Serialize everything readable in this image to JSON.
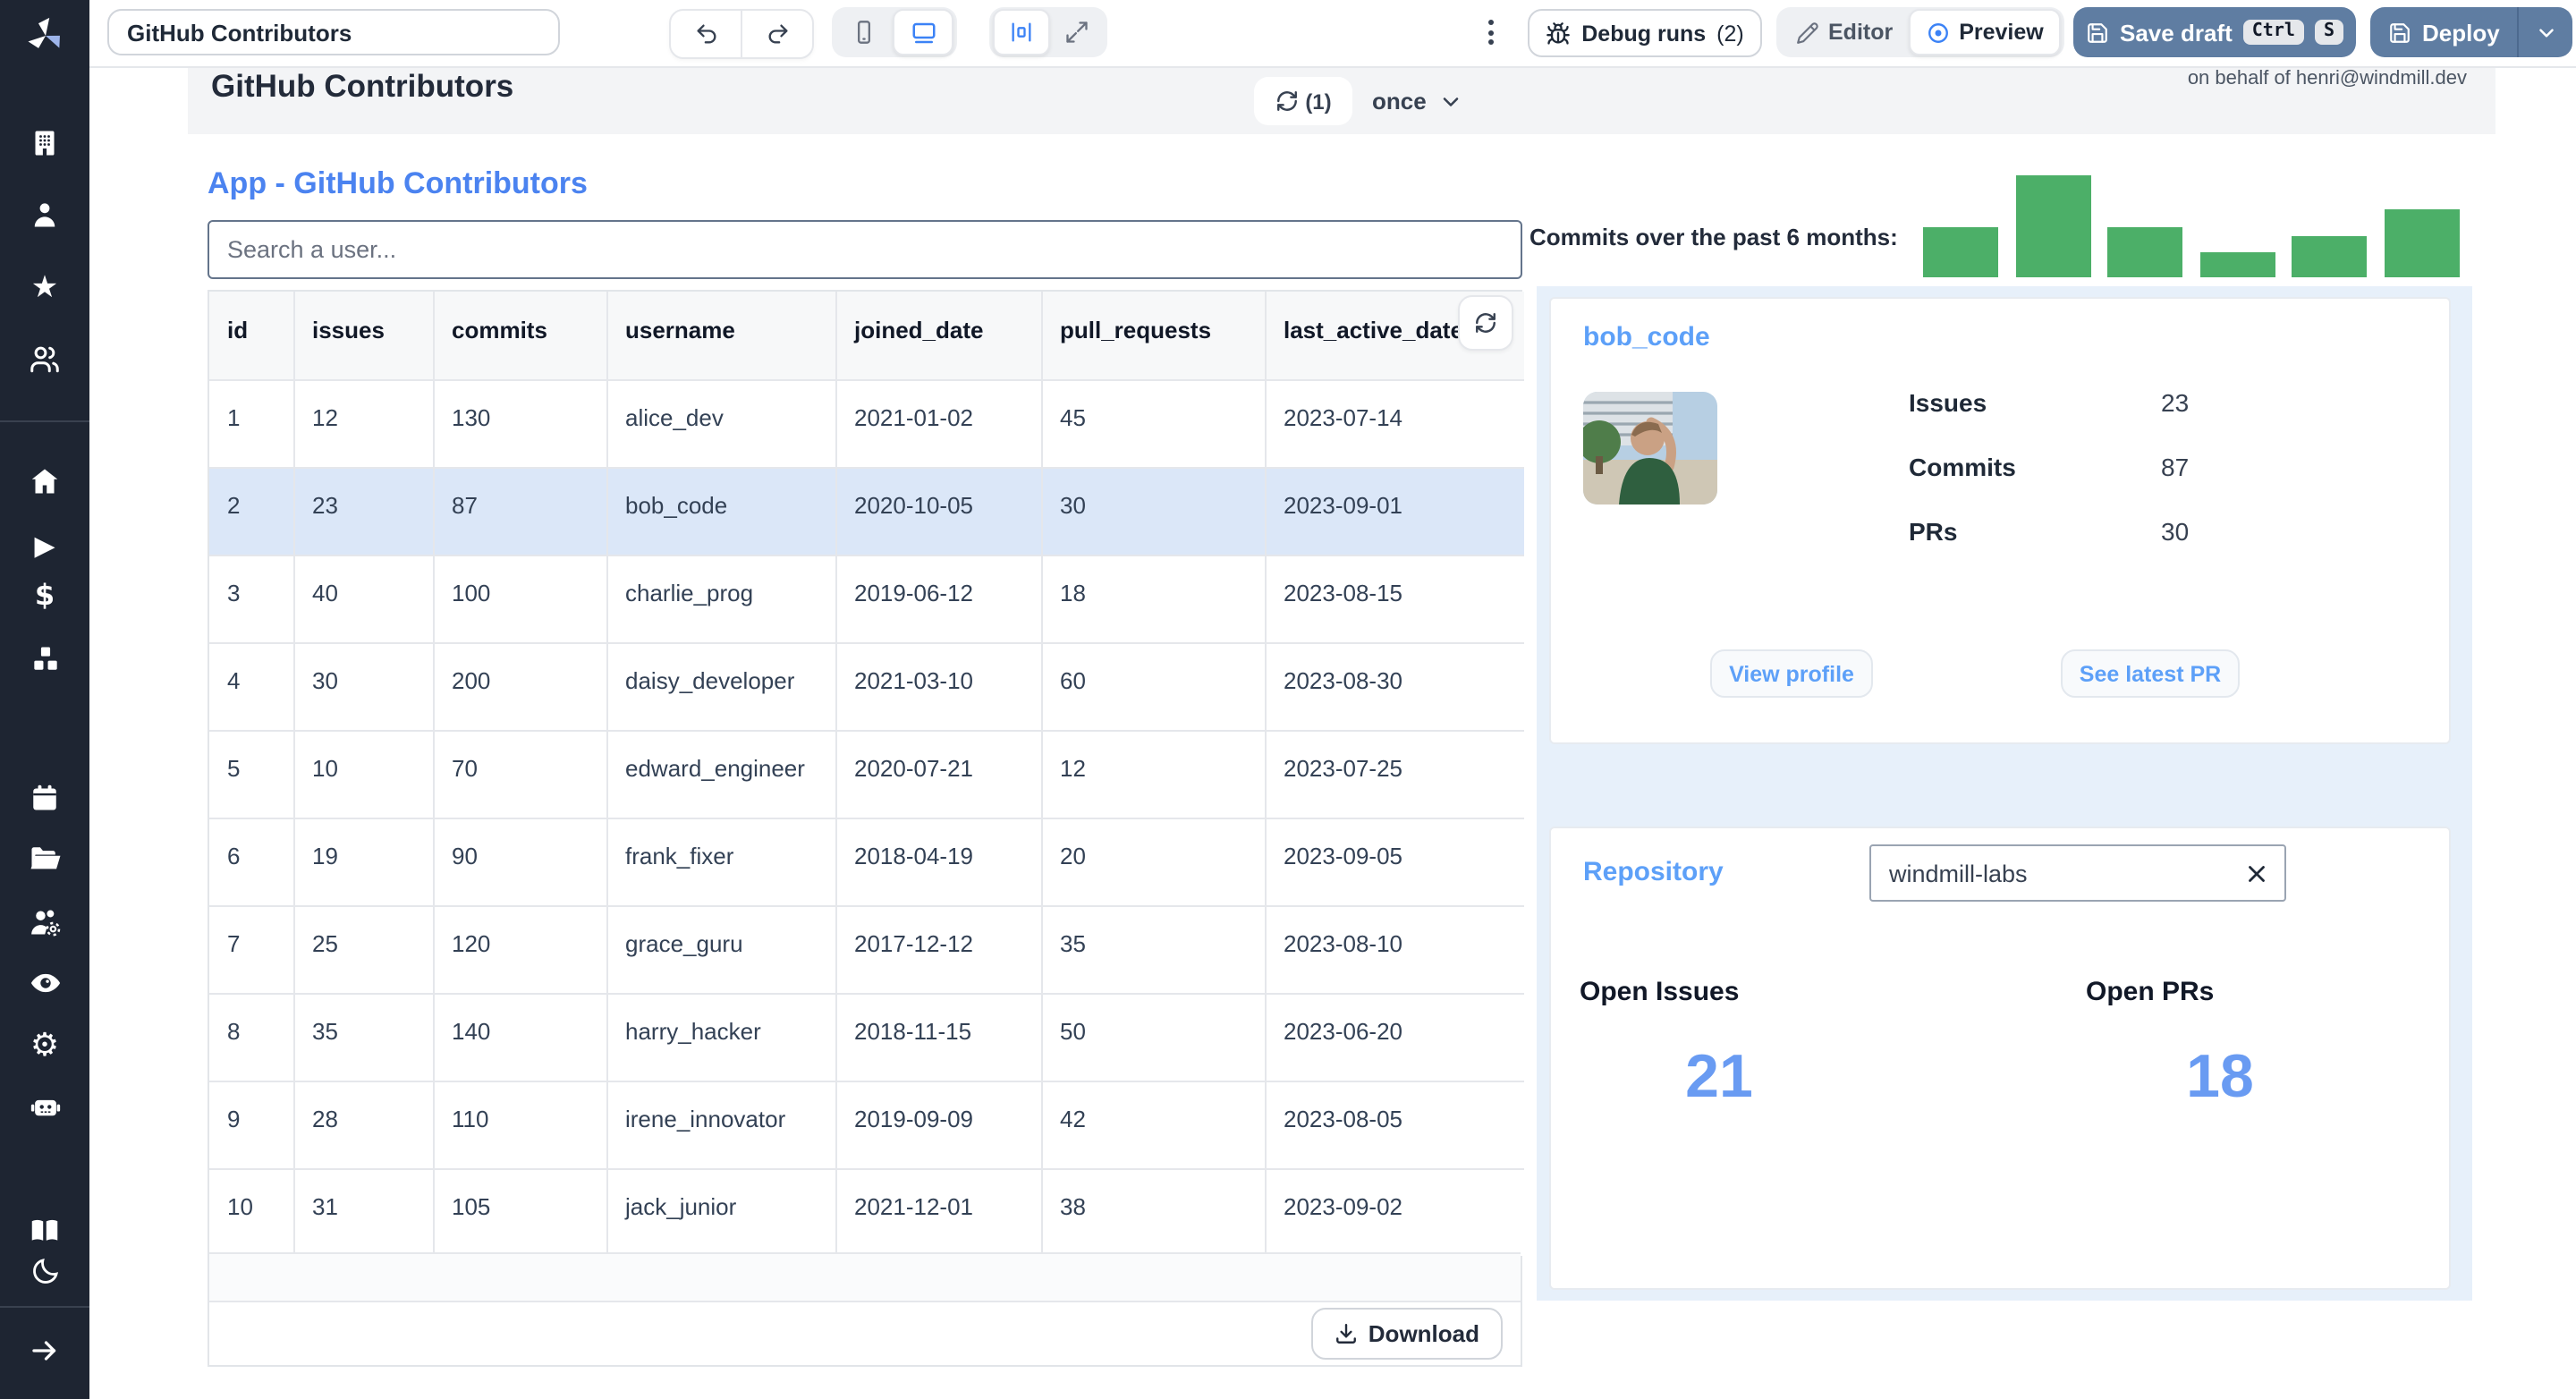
{
  "sidebar": {
    "icons": [
      "windmill-logo",
      "building",
      "user",
      "star",
      "users",
      "home",
      "play",
      "dollar",
      "cubes",
      "calendar",
      "folder-open",
      "user-cog",
      "eye",
      "gear",
      "robot",
      "book-open",
      "moon",
      "arrow-right"
    ]
  },
  "toolbar": {
    "app_name_value": "GitHub Contributors",
    "debug_runs_label": "Debug runs",
    "debug_runs_count": "(2)",
    "editor_label": "Editor",
    "preview_label": "Preview",
    "save_draft_label": "Save draft",
    "kbd_ctrl": "Ctrl",
    "kbd_s": "S",
    "deploy_label": "Deploy"
  },
  "app_header": {
    "title": "GitHub Contributors",
    "refresh_count": "(1)",
    "schedule_value": "once",
    "on_behalf_text": "on behalf of henri@windmill.dev"
  },
  "content": {
    "app_title": "App - GitHub Contributors",
    "search_placeholder": "Search a user...",
    "download_label": "Download"
  },
  "table": {
    "columns": [
      "id",
      "issues",
      "commits",
      "username",
      "joined_date",
      "pull_requests",
      "last_active_date"
    ],
    "selected_row_index": 1,
    "rows": [
      [
        "1",
        "12",
        "130",
        "alice_dev",
        "2021-01-02",
        "45",
        "2023-07-14"
      ],
      [
        "2",
        "23",
        "87",
        "bob_code",
        "2020-10-05",
        "30",
        "2023-09-01"
      ],
      [
        "3",
        "40",
        "100",
        "charlie_prog",
        "2019-06-12",
        "18",
        "2023-08-15"
      ],
      [
        "4",
        "30",
        "200",
        "daisy_developer",
        "2021-03-10",
        "60",
        "2023-08-30"
      ],
      [
        "5",
        "10",
        "70",
        "edward_engineer",
        "2020-07-21",
        "12",
        "2023-07-25"
      ],
      [
        "6",
        "19",
        "90",
        "frank_fixer",
        "2018-04-19",
        "20",
        "2023-09-05"
      ],
      [
        "7",
        "25",
        "120",
        "grace_guru",
        "2017-12-12",
        "35",
        "2023-08-10"
      ],
      [
        "8",
        "35",
        "140",
        "harry_hacker",
        "2018-11-15",
        "50",
        "2023-06-20"
      ],
      [
        "9",
        "28",
        "110",
        "irene_innovator",
        "2019-09-09",
        "42",
        "2023-08-05"
      ],
      [
        "10",
        "31",
        "105",
        "jack_junior",
        "2021-12-01",
        "38",
        "2023-09-02"
      ]
    ]
  },
  "commits_chart": {
    "type": "bar",
    "label": "Commits over the past 6 months:",
    "values": [
      49,
      100,
      49,
      24,
      41,
      66
    ],
    "max_value": 100,
    "bar_color": "#4caf68"
  },
  "profile_card": {
    "username": "bob_code",
    "stats": [
      {
        "label": "Issues",
        "value": "23"
      },
      {
        "label": "Commits",
        "value": "87"
      },
      {
        "label": "PRs",
        "value": "30"
      }
    ],
    "view_profile_label": "View profile",
    "see_latest_pr_label": "See latest PR"
  },
  "repository_card": {
    "title": "Repository",
    "repo_input_value": "windmill-labs",
    "open_issues_label": "Open Issues",
    "open_prs_label": "Open PRs",
    "open_issues_value": "21",
    "open_prs_value": "18"
  },
  "colors": {
    "accent_blue": "#4b83f0",
    "light_blue_heading": "#5da0f8",
    "stat_number_blue": "#699bf2",
    "bar_green": "#4caf68",
    "panel_blue": "#e7f0fa",
    "action_button_blue": "#5f7da2",
    "sidebar_bg": "#1e2532",
    "selected_row_bg": "#dbe7f8"
  }
}
